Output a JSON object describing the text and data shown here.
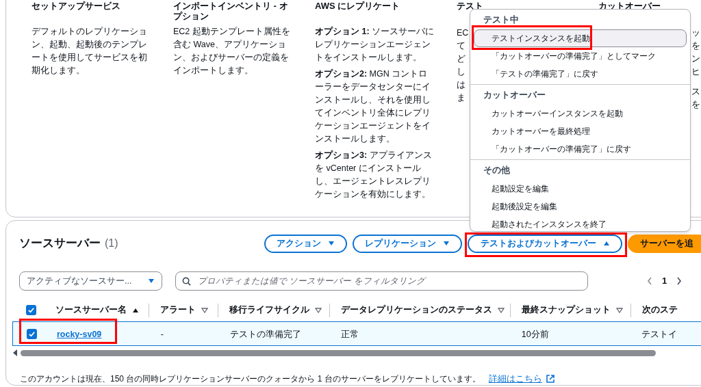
{
  "overview": {
    "columns": [
      {
        "title": "セットアップサービス",
        "paragraphs": [
          "デフォルトのレプリケーション、起動、起動後のテンプレートを使用してサービスを初期化します。"
        ]
      },
      {
        "title": "インポートインベントリ - オプション",
        "paragraphs": [
          "EC2 起動テンプレート属性を含む Wave、アプリケーション、およびサーバーの定義をインポートします。"
        ]
      },
      {
        "title": "AWS にレプリケート",
        "paragraphs": [
          "**オプション 1:** ソースサーバにレプリケーションエージェントをインストールします。",
          "**オプション2:** MGN コントローラーをデータセンターにインストールし、それを使用してインベントリ全体にレプリケーションエージェントをインストールします。",
          "**オプション3:** アプライアンスを vCenter にインストールし、エージェントレスレプリケーションを有効にします。"
        ]
      },
      {
        "title": "テスト",
        "fragments": [
          [
            "EC",
            "て",
            "ど",
            "し",
            "は",
            "ま"
          ]
        ]
      },
      {
        "title": "カットオーバー",
        "fragments": [
          [
            "ッ",
            "を",
            "ン",
            "ヒ"
          ],
          [
            "ス",
            "を"
          ]
        ]
      }
    ]
  },
  "menu": {
    "sections": [
      {
        "title": "テスト中",
        "items": [
          {
            "label": "テストインスタンスを起動",
            "selected": true
          },
          {
            "label": "「カットオーバーの準備完了」としてマーク",
            "selected": false
          },
          {
            "label": "「テストの準備完了」に戻す",
            "selected": false
          }
        ]
      },
      {
        "title": "カットオーバー",
        "items": [
          {
            "label": "カットオーバーインスタンスを起動",
            "selected": false
          },
          {
            "label": "カットオーバーを最終処理",
            "selected": false
          },
          {
            "label": "「カットオーバーの準備完了」に戻す",
            "selected": false
          }
        ]
      },
      {
        "title": "その他",
        "items": [
          {
            "label": "起動設定を編集",
            "selected": false
          },
          {
            "label": "起動後設定を編集",
            "selected": false
          },
          {
            "label": "起動されたインスタンスを終了",
            "selected": false
          }
        ]
      }
    ]
  },
  "source_servers": {
    "title": "ソースサーバー",
    "count": "(1)",
    "buttons": [
      {
        "label": "アクション",
        "kind": "dropdown",
        "expanded": false
      },
      {
        "label": "レプリケーション",
        "kind": "dropdown",
        "expanded": false
      },
      {
        "label": "テストおよびカットオーバー",
        "kind": "dropdown",
        "expanded": true
      },
      {
        "label": "サーバーを追",
        "kind": "primary"
      }
    ],
    "filter_select": "アクティブなソースサー...",
    "search": {
      "placeholder": "プロパティまたは値で ソースサーバー をフィルタリング"
    },
    "pagination": {
      "page": "1"
    },
    "table": {
      "all_checked": true,
      "columns": [
        {
          "label": "ソースサーバー名",
          "sorted": true,
          "filterable": false
        },
        {
          "label": "アラート",
          "sorted": false,
          "filterable": true
        },
        {
          "label": "移行ライフサイクル",
          "sorted": false,
          "filterable": true
        },
        {
          "label": "データレプリケーションのステータス",
          "sorted": false,
          "filterable": true
        },
        {
          "label": "最終スナップショット",
          "sorted": false,
          "filterable": true
        },
        {
          "label": "次のステ",
          "sorted": false,
          "filterable": false
        }
      ],
      "rows": [
        {
          "selected": true,
          "cells": [
            "rocky-sv09",
            "-",
            "テストの準備完了",
            "正常",
            "10分前",
            "テストイ"
          ]
        }
      ]
    },
    "footer": {
      "text": "このアカウントは現在、150 台の同時レプリケーションサーバーのクォータから 1 台のサーバーをレプリケートしています。",
      "link": "詳細はこちら"
    }
  }
}
